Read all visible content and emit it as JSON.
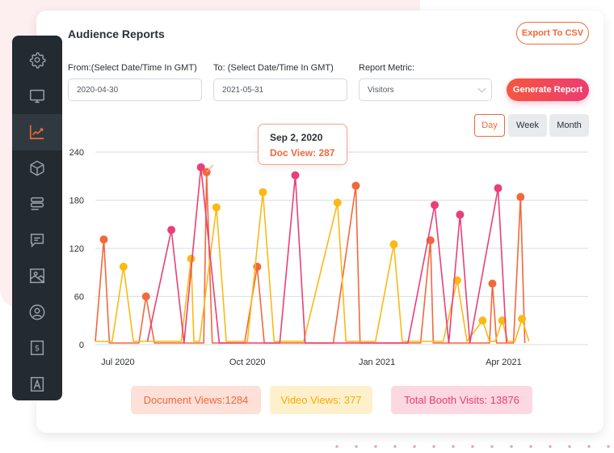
{
  "header": {
    "title": "Audience Reports",
    "export_label": "Export To CSV"
  },
  "filters": {
    "from_label": "From:(Select Date/Time In GMT)",
    "from_value": "2020-04-30",
    "to_label": "To: (Select Date/Time In GMT)",
    "to_value": "2021-05-31",
    "metric_label": "Report Metric:",
    "metric_value": "Visitors",
    "generate_label": "Generate Report"
  },
  "periods": [
    {
      "label": "Day",
      "active": true
    },
    {
      "label": "Week",
      "active": false
    },
    {
      "label": "Month",
      "active": false
    }
  ],
  "sidebar": {
    "items": [
      {
        "icon": "gear-icon",
        "active": false
      },
      {
        "icon": "monitor-icon",
        "active": false
      },
      {
        "icon": "chart-trend-icon",
        "active": true
      },
      {
        "icon": "cube-icon",
        "active": false
      },
      {
        "icon": "list-icon",
        "active": false
      },
      {
        "icon": "chat-icon",
        "active": false
      },
      {
        "icon": "image-icon",
        "active": false
      },
      {
        "icon": "user-circle-icon",
        "active": false
      },
      {
        "icon": "dollar-icon",
        "active": false
      },
      {
        "icon": "font-icon",
        "active": false
      }
    ]
  },
  "tooltip": {
    "date": "Sep 2, 2020",
    "value_text": "Doc View: 287"
  },
  "summary": {
    "document_views": "Document Views:1284",
    "video_views": "Video Views: 377",
    "booth_visits": "Total Booth Visits: 13876"
  },
  "colors": {
    "doc": "#f2683b",
    "video": "#fbb913",
    "booth": "#ea3f76",
    "accent": "#f0683a"
  },
  "chart_data": {
    "type": "line",
    "title": "",
    "xlabel": "",
    "ylabel": "",
    "x_range": [
      "2020-06-15",
      "2021-05-31"
    ],
    "ylim": [
      0,
      240
    ],
    "yticks": [
      0,
      60,
      120,
      180,
      240
    ],
    "xticks": [
      {
        "date": "2020-07-01",
        "label": "Jul 2020"
      },
      {
        "date": "2020-10-01",
        "label": "Oct 2020"
      },
      {
        "date": "2021-01-01",
        "label": "Jan 2021"
      },
      {
        "date": "2021-04-01",
        "label": "Apr 2021"
      }
    ],
    "grid": true,
    "legend": "none",
    "series": [
      {
        "name": "Document Views",
        "color": "#f2683b",
        "points": [
          [
            "2020-06-15",
            4
          ],
          [
            "2020-06-21",
            131
          ],
          [
            "2020-06-25",
            2
          ],
          [
            "2020-07-16",
            2
          ],
          [
            "2020-07-21",
            60
          ],
          [
            "2020-07-27",
            2
          ],
          [
            "2020-08-31",
            2
          ],
          [
            "2020-09-02",
            215
          ],
          [
            "2020-09-06",
            2
          ],
          [
            "2020-09-29",
            2
          ],
          [
            "2020-10-08",
            97
          ],
          [
            "2020-10-13",
            2
          ],
          [
            "2020-12-01",
            2
          ],
          [
            "2020-12-17",
            198
          ],
          [
            "2020-12-20",
            2
          ],
          [
            "2021-02-01",
            2
          ],
          [
            "2021-02-08",
            130
          ],
          [
            "2021-02-10",
            2
          ],
          [
            "2021-03-22",
            2
          ],
          [
            "2021-03-24",
            76
          ],
          [
            "2021-03-27",
            2
          ],
          [
            "2021-04-08",
            2
          ],
          [
            "2021-04-13",
            184
          ],
          [
            "2021-04-16",
            2
          ]
        ]
      },
      {
        "name": "Video Views",
        "color": "#fbb913",
        "points": [
          [
            "2020-06-15",
            4
          ],
          [
            "2020-06-27",
            4
          ],
          [
            "2020-07-05",
            97
          ],
          [
            "2020-07-12",
            4
          ],
          [
            "2020-08-15",
            4
          ],
          [
            "2020-08-22",
            107
          ],
          [
            "2020-08-24",
            4
          ],
          [
            "2020-08-28",
            4
          ],
          [
            "2020-09-09",
            171
          ],
          [
            "2020-09-16",
            4
          ],
          [
            "2020-09-28",
            4
          ],
          [
            "2020-10-01",
            4
          ],
          [
            "2020-10-12",
            190
          ],
          [
            "2020-10-20",
            4
          ],
          [
            "2020-11-10",
            4
          ],
          [
            "2020-12-04",
            177
          ],
          [
            "2020-12-10",
            4
          ],
          [
            "2020-12-31",
            4
          ],
          [
            "2021-01-13",
            125
          ],
          [
            "2021-01-19",
            4
          ],
          [
            "2021-02-17",
            4
          ],
          [
            "2021-02-27",
            80
          ],
          [
            "2021-03-06",
            4
          ],
          [
            "2021-03-17",
            30
          ],
          [
            "2021-03-22",
            4
          ],
          [
            "2021-03-26",
            4
          ],
          [
            "2021-03-31",
            30
          ],
          [
            "2021-04-04",
            4
          ],
          [
            "2021-04-09",
            4
          ],
          [
            "2021-04-14",
            32
          ],
          [
            "2021-04-19",
            4
          ]
        ]
      },
      {
        "name": "Booth Visits",
        "color": "#ea3f76",
        "points": [
          [
            "2020-07-22",
            4
          ],
          [
            "2020-08-08",
            143
          ],
          [
            "2020-08-17",
            2
          ],
          [
            "2020-08-29",
            221
          ],
          [
            "2020-09-11",
            2
          ],
          [
            "2020-10-24",
            2
          ],
          [
            "2020-11-04",
            211
          ],
          [
            "2020-11-11",
            2
          ],
          [
            "2021-01-23",
            2
          ],
          [
            "2021-02-11",
            174
          ],
          [
            "2021-02-21",
            2
          ],
          [
            "2021-03-01",
            162
          ],
          [
            "2021-03-08",
            2
          ],
          [
            "2021-03-28",
            195
          ],
          [
            "2021-04-03",
            2
          ]
        ]
      }
    ],
    "tooltip": {
      "date": "Sep 2, 2020",
      "series": "Doc View",
      "value": 287
    }
  }
}
